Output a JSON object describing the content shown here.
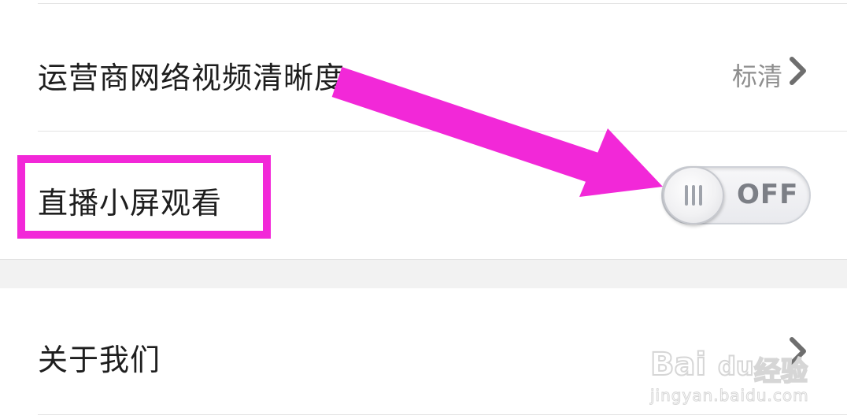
{
  "settings": {
    "rows": [
      {
        "label": "运营商网络视频清晰度",
        "value": "标清"
      },
      {
        "label": "直播小屏观看",
        "toggle_state": "OFF"
      },
      {
        "label": "关于我们"
      }
    ]
  },
  "watermark": {
    "brand": "Bai",
    "brand_tail": "du",
    "suffix": "经验",
    "url": "jingyan.baidu.com"
  },
  "colors": {
    "annotation": "#f228d8",
    "label": "#1e1e1e",
    "secondary": "#8e8e8e",
    "section_gap": "#f2f2f2"
  }
}
